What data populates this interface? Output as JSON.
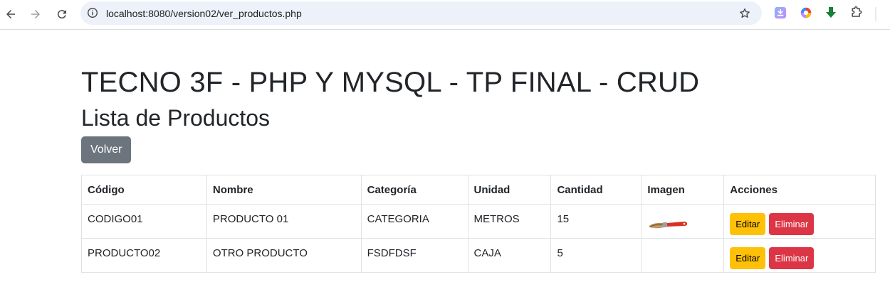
{
  "browser": {
    "url": "localhost:8080/version02/ver_productos.php"
  },
  "page": {
    "title": "TECNO 3F - PHP Y MYSQL - TP FINAL - CRUD",
    "subtitle": "Lista de Productos",
    "back_button": "Volver"
  },
  "table": {
    "headers": {
      "codigo": "Código",
      "nombre": "Nombre",
      "categoria": "Categoría",
      "unidad": "Unidad",
      "cantidad": "Cantidad",
      "imagen": "Imagen",
      "acciones": "Acciones"
    },
    "rows": [
      {
        "codigo": "CODIGO01",
        "nombre": "PRODUCTO 01",
        "categoria": "CATEGORIA",
        "unidad": "METROS",
        "cantidad": "15",
        "imagen": "wire-brush-image",
        "edit": "Editar",
        "delete": "Eliminar"
      },
      {
        "codigo": "PRODUCTO02",
        "nombre": "OTRO PRODUCTO",
        "categoria": "FSDFDSF",
        "unidad": "CAJA",
        "cantidad": "5",
        "imagen": "",
        "edit": "Editar",
        "delete": "Eliminar"
      }
    ]
  },
  "colors": {
    "secondary": "#6c757d",
    "warning": "#ffc107",
    "danger": "#dc3545",
    "omnibox": "#edf2fa"
  }
}
